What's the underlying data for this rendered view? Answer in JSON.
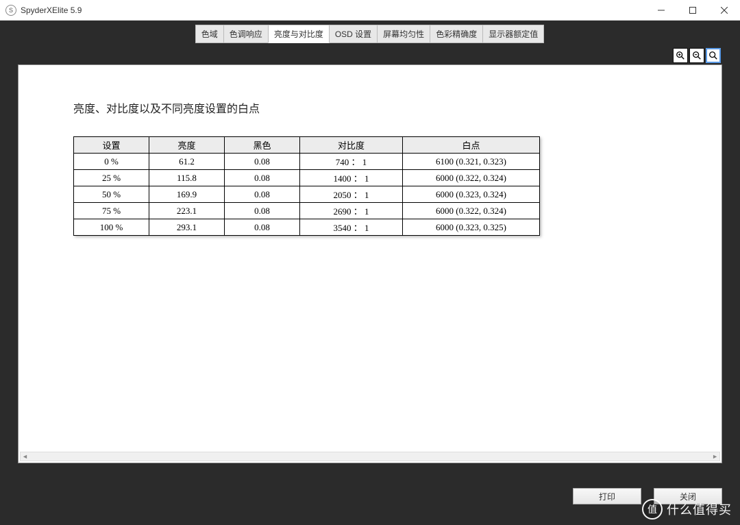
{
  "window": {
    "title": "SpyderXElite 5.9",
    "icon_letter": "S"
  },
  "tabs": [
    {
      "label": "色域"
    },
    {
      "label": "色调响应"
    },
    {
      "label": "亮度与对比度",
      "active": true
    },
    {
      "label": "OSD 设置"
    },
    {
      "label": "屏幕均匀性"
    },
    {
      "label": "色彩精确度"
    },
    {
      "label": "显示器额定值"
    }
  ],
  "page": {
    "title": "亮度、对比度以及不同亮度设置的白点"
  },
  "chart_data": {
    "type": "table",
    "columns": [
      "设置",
      "亮度",
      "黑色",
      "对比度",
      "白点"
    ],
    "rows": [
      {
        "setting": "0 %",
        "brightness": "61.2",
        "black": "0.08",
        "contrast": "740 ： 1",
        "whitepoint": "6100  (0.321, 0.323)"
      },
      {
        "setting": "25 %",
        "brightness": "115.8",
        "black": "0.08",
        "contrast": "1400 ： 1",
        "whitepoint": "6000  (0.322, 0.324)"
      },
      {
        "setting": "50 %",
        "brightness": "169.9",
        "black": "0.08",
        "contrast": "2050 ： 1",
        "whitepoint": "6000  (0.323, 0.324)"
      },
      {
        "setting": "75 %",
        "brightness": "223.1",
        "black": "0.08",
        "contrast": "2690 ： 1",
        "whitepoint": "6000  (0.322, 0.324)"
      },
      {
        "setting": "100 %",
        "brightness": "293.1",
        "black": "0.08",
        "contrast": "3540 ： 1",
        "whitepoint": "6000  (0.323, 0.325)"
      }
    ]
  },
  "buttons": {
    "print": "打印",
    "close": "关闭"
  },
  "watermark": {
    "circle": "值",
    "text": "什么值得买"
  }
}
